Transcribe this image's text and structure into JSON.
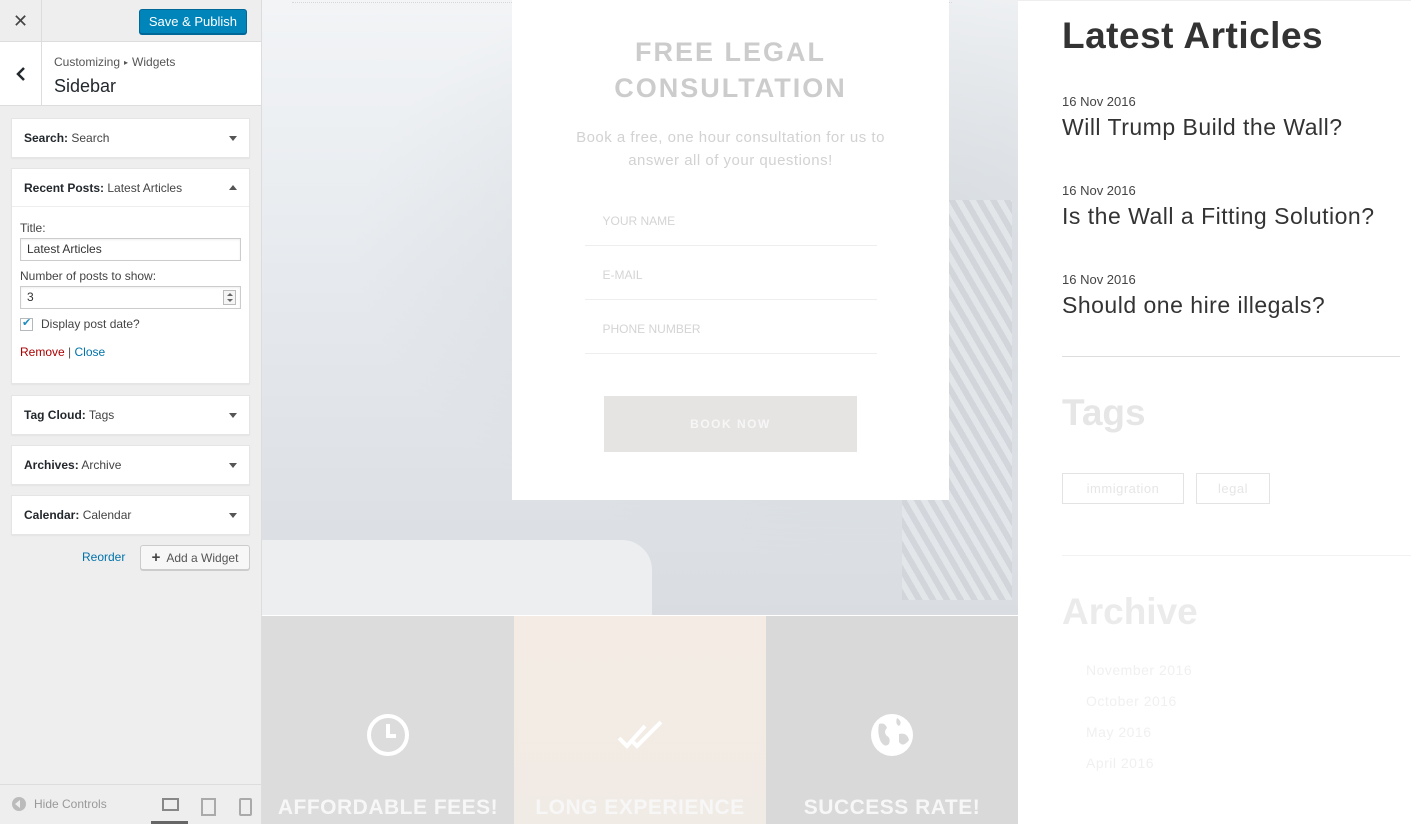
{
  "customizer": {
    "close_icon": "close-icon",
    "publish_label": "Save & Publish",
    "breadcrumb": {
      "root": "Customizing",
      "separator": "▸",
      "current": "Widgets"
    },
    "section_title": "Sidebar",
    "widgets": [
      {
        "type": "Search:",
        "title": "Search",
        "state": "collapsed"
      },
      {
        "type": "Recent Posts:",
        "title": "Latest Articles",
        "state": "expanded"
      },
      {
        "type": "Tag Cloud:",
        "title": "Tags",
        "state": "collapsed"
      },
      {
        "type": "Archives:",
        "title": "Archive",
        "state": "collapsed"
      },
      {
        "type": "Calendar:",
        "title": "Calendar",
        "state": "collapsed"
      }
    ],
    "recent_posts_form": {
      "title_label": "Title:",
      "title_value": "Latest Articles",
      "count_label": "Number of posts to show:",
      "count_value": "3",
      "show_date_label": "Display post date?",
      "show_date_checked": true,
      "remove_label": "Remove",
      "divider": "|",
      "close_label": "Close"
    },
    "reorder_label": "Reorder",
    "add_widget_label": "Add a Widget",
    "hide_controls_label": "Hide Controls",
    "devices": [
      "desktop",
      "tablet",
      "mobile"
    ],
    "active_device": "desktop",
    "accent_color": "#0085ba"
  },
  "preview": {
    "consultation": {
      "title_line1": "FREE LEGAL",
      "title_line2": "CONSULTATION",
      "subtitle": "Book a free, one hour consultation for us to answer all of your questions!",
      "fields": [
        "YOUR NAME",
        "E-MAIL",
        "PHONE NUMBER"
      ],
      "button_label": "BOOK NOW"
    },
    "features": [
      {
        "icon": "clock-icon",
        "title": "AFFORDABLE FEES!"
      },
      {
        "icon": "double-check-icon",
        "title": "LONG EXPERIENCE"
      },
      {
        "icon": "globe-icon",
        "title": "SUCCESS RATE!"
      }
    ],
    "sidebar": {
      "latest_title": "Latest Articles",
      "posts": [
        {
          "date": "16 Nov 2016",
          "title": "Will Trump Build the Wall?"
        },
        {
          "date": "16 Nov 2016",
          "title": "Is the Wall a Fitting Solution?"
        },
        {
          "date": "16 Nov 2016",
          "title": "Should one hire illegals?"
        }
      ],
      "tags_title": "Tags",
      "tags": [
        "immigration",
        "legal"
      ],
      "archive_title": "Archive",
      "archives": [
        "November 2016",
        "October 2016",
        "May 2016",
        "April 2016"
      ]
    }
  }
}
